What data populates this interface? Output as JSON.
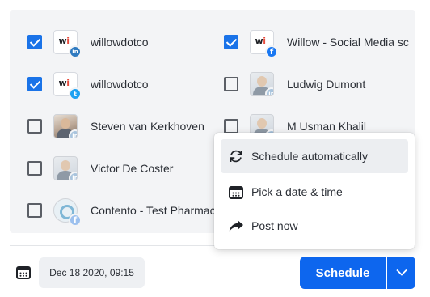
{
  "accounts": [
    {
      "name": "willowdotco",
      "checked": true,
      "network": "linkedin",
      "avatar": "wi-logo"
    },
    {
      "name": "Willow - Social Media sc",
      "checked": true,
      "network": "facebook",
      "avatar": "wi-logo"
    },
    {
      "name": "willowdotco",
      "checked": true,
      "network": "twitter",
      "avatar": "wi-logo"
    },
    {
      "name": "Ludwig Dumont",
      "checked": false,
      "network": "linkedin",
      "avatar": "photo"
    },
    {
      "name": "Steven van Kerkhoven",
      "checked": false,
      "network": "linkedin",
      "avatar": "photo"
    },
    {
      "name": "M Usman Khalil",
      "checked": false,
      "network": "linkedin",
      "avatar": "photo"
    },
    {
      "name": "Victor De Coster",
      "checked": false,
      "network": "linkedin",
      "avatar": "photo"
    },
    {
      "name": "Contento - Test Pharmac",
      "checked": false,
      "network": "facebook",
      "avatar": "logo"
    }
  ],
  "logo_text": {
    "w": "w",
    "i": "i"
  },
  "badges": {
    "linkedin": "in",
    "facebook": "f",
    "twitter": "t"
  },
  "footer": {
    "calendar_icon": "calendar-icon",
    "date": "Dec 18 2020, 09:15",
    "schedule_label": "Schedule",
    "dropdown_icon": "chevron-down-icon"
  },
  "menu": {
    "items": [
      {
        "label": "Schedule automatically",
        "icon": "refresh-icon",
        "active": true
      },
      {
        "label": "Pick a date & time",
        "icon": "calendar-icon",
        "active": false
      },
      {
        "label": "Post now",
        "icon": "share-arrow-icon",
        "active": false
      }
    ]
  },
  "colors": {
    "accent": "#0d66ee",
    "checkbox": "#1a73e8",
    "panel": "#f3f4f6"
  }
}
